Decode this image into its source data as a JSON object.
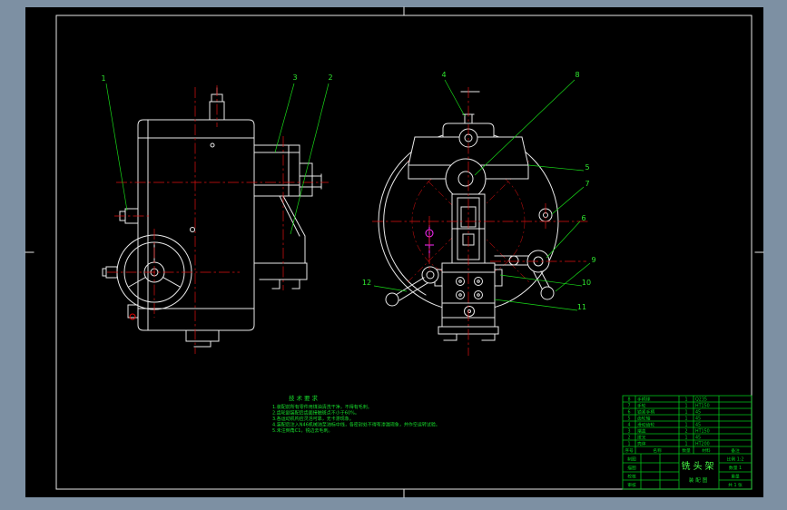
{
  "canvas": {
    "background": "#7d90a3",
    "sheet": "#000000"
  },
  "colors": {
    "line": "#e9e9e9",
    "green": "#17dd2c",
    "red": "#dd1111",
    "magenta": "#ff2bff"
  },
  "callouts": [
    {
      "label": "1"
    },
    {
      "label": "2"
    },
    {
      "label": "3"
    },
    {
      "label": "4"
    },
    {
      "label": "5"
    },
    {
      "label": "6"
    },
    {
      "label": "7"
    },
    {
      "label": "8"
    },
    {
      "label": "9"
    },
    {
      "label": "10"
    },
    {
      "label": "11"
    },
    {
      "label": "12"
    }
  ],
  "notes": {
    "heading": "技术要求",
    "lines": [
      "1.装配前所有零件用煤油清洗干净，不得有毛刺。",
      "2.齿轮副装配后齿面接触斑点不小于60%。",
      "3.各运动机构应灵活可靠，无卡滞现象。",
      "4.装配后注入N46机械油至油标中线，各密封处不得有渗漏现象，并作空运转试验。",
      "5.未注倒角C1，锐边去毛刺。"
    ]
  },
  "title_block": {
    "bom_header": [
      "序号",
      "名称",
      "数量",
      "材料",
      "备注"
    ],
    "bom": [
      [
        "8",
        "手柄球",
        "1",
        "Q235"
      ],
      [
        "7",
        "手轮",
        "1",
        "HT150"
      ],
      [
        "6",
        "锁紧手柄",
        "1",
        "45"
      ],
      [
        "5",
        "齿轮轴",
        "1",
        "45"
      ],
      [
        "4",
        "滑动齿轮",
        "1",
        "45"
      ],
      [
        "3",
        "端盖",
        "2",
        "HT150"
      ],
      [
        "2",
        "拨叉",
        "1",
        "45"
      ],
      [
        "1",
        "壳体",
        "1",
        "HT200"
      ]
    ],
    "sign_rows": [
      "制图",
      "描图",
      "校核",
      "审核"
    ],
    "title_main": "铣头架",
    "title_sub": "装配图",
    "info_rows": [
      "比例 1:2",
      "数量 1",
      "重量",
      "共 1 张"
    ]
  }
}
